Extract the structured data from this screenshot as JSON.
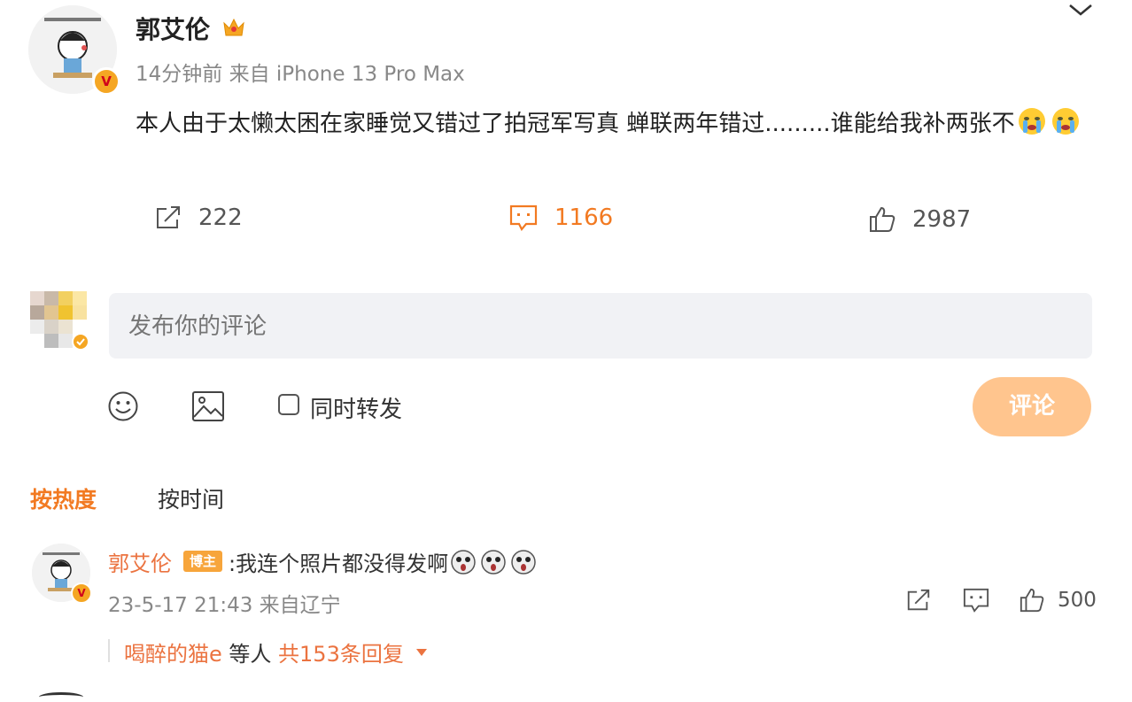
{
  "post": {
    "username": "郭艾伦",
    "meta": "14分钟前 来自 iPhone 13 Pro Max",
    "text": "本人由于太懒太困在家睡觉又错过了拍冠军写真 蝉联两年错过.........谁能给我补两张不"
  },
  "actions": {
    "repost_count": "222",
    "comment_count": "1166",
    "like_count": "2987"
  },
  "compose": {
    "placeholder": "发布你的评论",
    "repost_label": "同时转发",
    "submit_label": "评论"
  },
  "sort_tabs": {
    "hot": "按热度",
    "time": "按时间"
  },
  "comment": {
    "username": "郭艾伦",
    "badge": "博主",
    "text": ":我连个照片都没得发啊",
    "meta": "23-5-17 21:43 来自辽宁",
    "like_count": "500",
    "reply_names": "喝醉的猫e",
    "reply_mid": " 等人 ",
    "reply_count": "共153条回复"
  },
  "colors": {
    "accent": "#f27a22",
    "name_orange": "#eb7340",
    "submit_bg": "#ffc58e",
    "input_bg": "#f1f2f5"
  },
  "icons": [
    "chevron-down-icon",
    "crown-icon",
    "crying-emoji-icon",
    "repost-icon",
    "comment-icon",
    "like-icon",
    "smile-icon",
    "image-icon",
    "scream-emoji-icon",
    "dropdown-caret-icon"
  ]
}
